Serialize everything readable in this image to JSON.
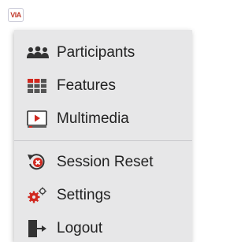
{
  "app": {
    "logo_text": "VIA"
  },
  "menu": {
    "items": [
      {
        "label": "Participants",
        "icon": "participants-icon"
      },
      {
        "label": "Features",
        "icon": "features-grid-icon"
      },
      {
        "label": "Multimedia",
        "icon": "multimedia-icon"
      },
      {
        "label": "Session Reset",
        "icon": "session-reset-icon"
      },
      {
        "label": "Settings",
        "icon": "settings-gears-icon"
      },
      {
        "label": "Logout",
        "icon": "logout-icon"
      }
    ]
  },
  "colors": {
    "menu_background": "#e7e7e8",
    "text": "#222222",
    "icon_red": "#d0281f",
    "icon_dark": "#333333"
  }
}
